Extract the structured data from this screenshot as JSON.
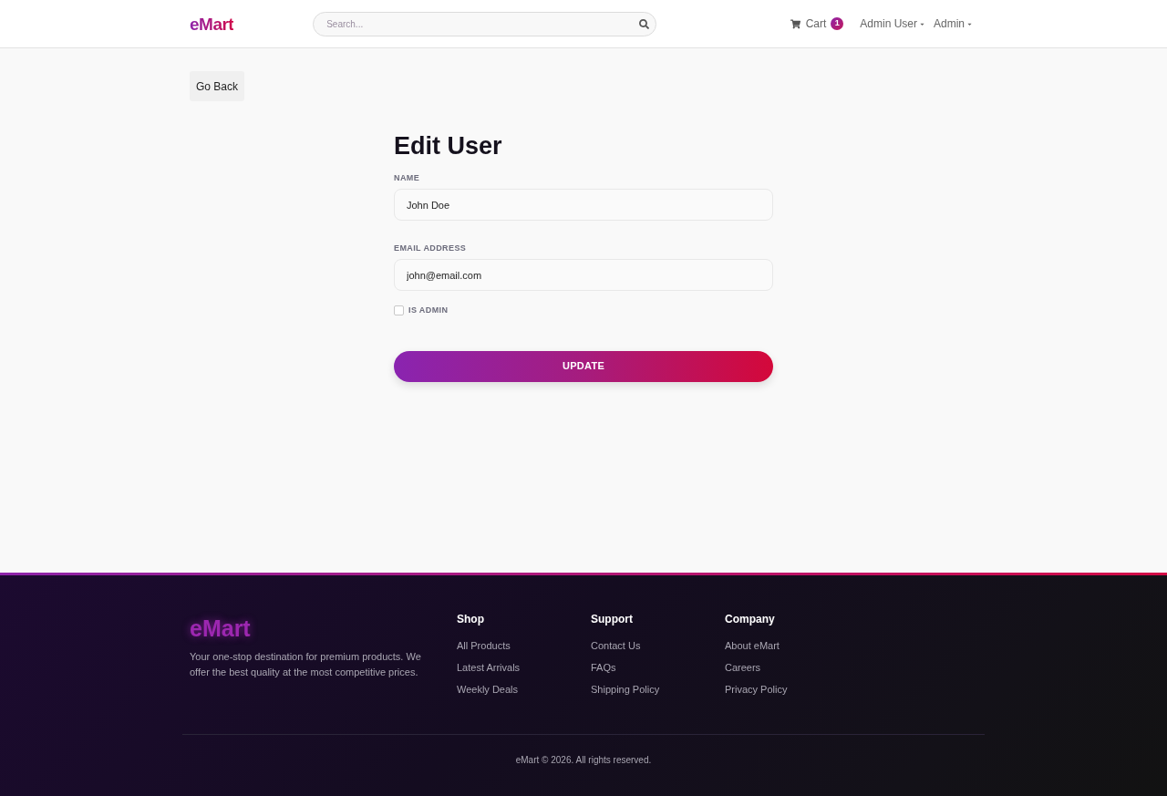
{
  "header": {
    "logo": "eMart",
    "search": {
      "placeholder": "Search..."
    },
    "cart": {
      "label": "Cart",
      "count": "1"
    },
    "menus": [
      {
        "label": "Admin User"
      },
      {
        "label": "Admin"
      }
    ]
  },
  "back_button": "Go Back",
  "form": {
    "title": "Edit User",
    "fields": [
      {
        "label": "NAME",
        "value": "John Doe"
      },
      {
        "label": "EMAIL ADDRESS",
        "value": "john@email.com"
      }
    ],
    "is_admin": {
      "label": "IS ADMIN",
      "checked": false
    },
    "submit": "UPDATE"
  },
  "footer": {
    "logo": "eMart",
    "description": "Your one-stop destination for premium products. We offer the best quality at the most competitive prices.",
    "columns": [
      {
        "heading": "Shop",
        "links": [
          "All Products",
          "Latest Arrivals",
          "Weekly Deals"
        ]
      },
      {
        "heading": "Support",
        "links": [
          "Contact Us",
          "FAQs",
          "Shipping Policy"
        ]
      },
      {
        "heading": "Company",
        "links": [
          "About eMart",
          "Careers",
          "Privacy Policy"
        ]
      }
    ],
    "copyright": "eMart © 2026. All rights reserved."
  }
}
